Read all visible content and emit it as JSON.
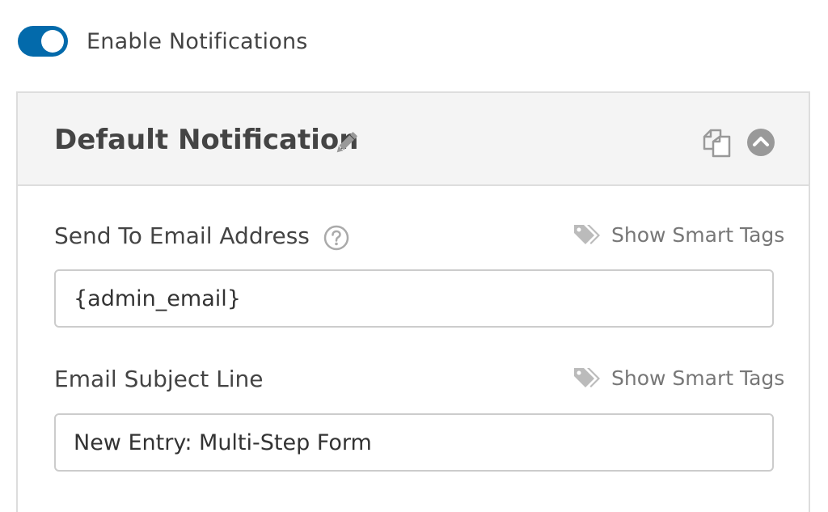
{
  "enable": {
    "label": "Enable Notifications",
    "checked": true
  },
  "panel": {
    "title": "Default Notification",
    "icons": {
      "edit": "pencil-icon",
      "clone": "clone-icon",
      "collapse": "chevron-up-circle-icon"
    }
  },
  "fields": [
    {
      "label": "Send To Email Address",
      "has_help": true,
      "smart_tags_label": "Show Smart Tags",
      "value": "{admin_email}"
    },
    {
      "label": "Email Subject Line",
      "has_help": false,
      "smart_tags_label": "Show Smart Tags",
      "value": "New Entry: Multi-Step Form"
    }
  ],
  "colors": {
    "toggle_on": "#036aab",
    "header_bg": "#f4f4f4",
    "border": "#dddddd",
    "muted": "#999999"
  }
}
